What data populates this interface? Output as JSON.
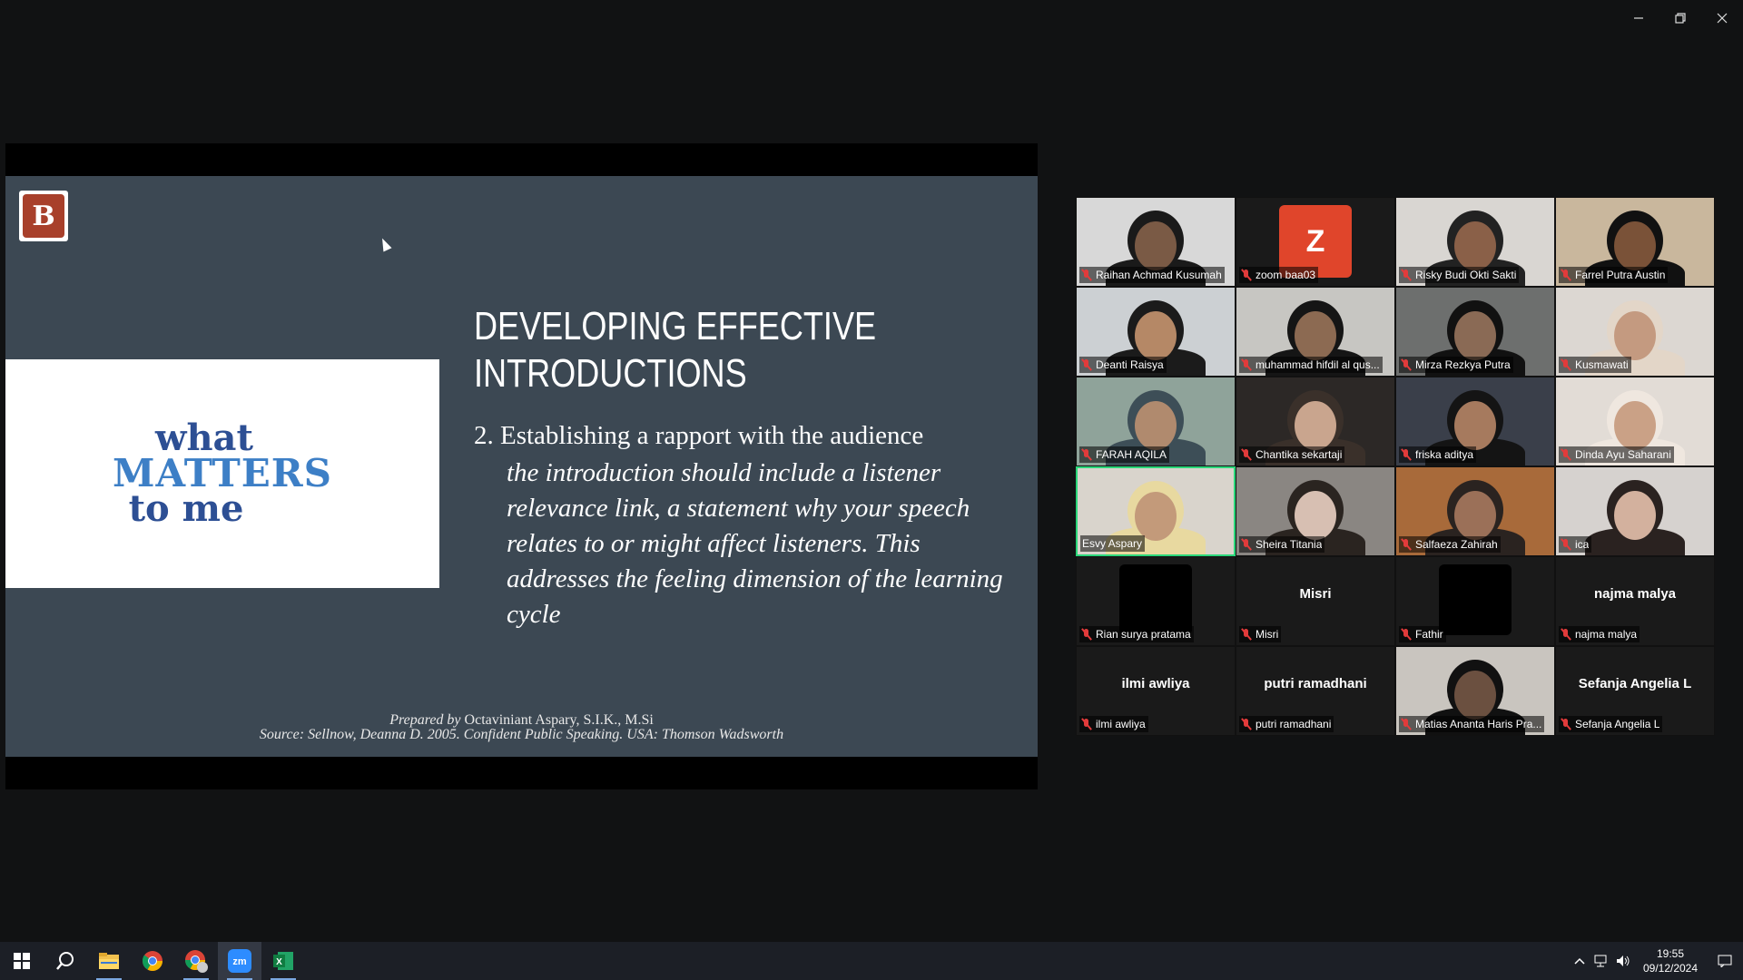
{
  "window": {
    "controls": [
      "minimize",
      "restore",
      "close"
    ]
  },
  "slide": {
    "logo_letter": "B",
    "image_text": [
      "what",
      "MATTERS",
      "to me"
    ],
    "title_line1": "DEVELOPING EFFECTIVE",
    "title_line2": "INTRODUCTIONS",
    "point": "2.  Establishing a rapport with the audience",
    "body": "the introduction should include a listener relevance link, a statement why your speech relates to or might affect listeners. This addresses the feeling dimension of the learning cycle",
    "prepared_label": "Prepared by",
    "prepared_name": "Octaviniant Aspary, S.I.K., M.Si",
    "source": "Source: Sellnow, Deanna D. 2005. Confident Public Speaking. USA: Thomson Wadsworth"
  },
  "participants": [
    {
      "name": "Raihan Achmad Kusumah",
      "type": "video",
      "bg": "#d8d8d8",
      "skin": "#7a5a45",
      "hair": "#1a1a1a"
    },
    {
      "name": "zoom baa03",
      "type": "avatar",
      "letter": "Z"
    },
    {
      "name": "Risky Budi Okti Sakti",
      "type": "video",
      "bg": "#d9d6d2",
      "skin": "#8a6048",
      "hair": "#222"
    },
    {
      "name": "Farrel Putra Austin",
      "type": "video",
      "bg": "#c9b79d",
      "skin": "#7a5238",
      "hair": "#111"
    },
    {
      "name": "Deanti Raisya",
      "type": "video",
      "bg": "#ccd0d3",
      "skin": "#b58866",
      "hair": "#1b1b1b"
    },
    {
      "name": "muhammad hifdil al qus...",
      "type": "video",
      "bg": "#c7c6c2",
      "skin": "#8c6a52",
      "hair": "#151515"
    },
    {
      "name": "Mirza Rezkya Putra",
      "type": "video",
      "bg": "#6d6f6e",
      "skin": "#8a6a55",
      "hair": "#111"
    },
    {
      "name": "Kusmawati",
      "type": "video",
      "bg": "#dcd7d2",
      "skin": "#c49a80",
      "hair": "#e3d6c8"
    },
    {
      "name": "FARAH AQILA",
      "type": "video",
      "bg": "#8fa39a",
      "skin": "#b08a6e",
      "hair": "#3d4e57"
    },
    {
      "name": "Chantika sekartaji",
      "type": "video",
      "bg": "#2c2826",
      "skin": "#c9a58e",
      "hair": "#3a302a"
    },
    {
      "name": "friska aditya",
      "type": "video",
      "bg": "#3a3f4a",
      "skin": "#a67a5e",
      "hair": "#141414"
    },
    {
      "name": "Dinda Ayu Saharani",
      "type": "video",
      "bg": "#e2dcd6",
      "skin": "#caa186",
      "hair": "#efe7df"
    },
    {
      "name": "Esvy Aspary",
      "type": "video",
      "bg": "#d9d4cc",
      "skin": "#c39a7a",
      "hair": "#e8d9a0",
      "active": true
    },
    {
      "name": "Sheira Titania",
      "type": "video",
      "bg": "#8a8682",
      "skin": "#d7bfb2",
      "hair": "#2a2420"
    },
    {
      "name": "Salfaeza Zahirah",
      "type": "video",
      "bg": "#a86a3a",
      "skin": "#9b7058",
      "hair": "#2a2320"
    },
    {
      "name": "ica",
      "type": "video",
      "bg": "#d6d2cf",
      "skin": "#d3b19e",
      "hair": "#2a2220"
    },
    {
      "name": "Rian surya pratama",
      "type": "blank"
    },
    {
      "name": "Misri",
      "type": "name-only"
    },
    {
      "name": "Fathir",
      "type": "blank"
    },
    {
      "name": "najma malya",
      "type": "name-only"
    },
    {
      "name": "ilmi awliya",
      "type": "name-only"
    },
    {
      "name": "putri ramadhani",
      "type": "name-only"
    },
    {
      "name": "Matias Ananta Haris Pra...",
      "type": "video",
      "bg": "#c9c5bf",
      "skin": "#6b5040",
      "hair": "#111"
    },
    {
      "name": "Sefanja Angelia L",
      "type": "name-only"
    }
  ],
  "taskbar": {
    "apps": [
      "start-button",
      "search",
      "file-explorer",
      "chrome",
      "chrome-profile",
      "zoom",
      "excel"
    ],
    "time": "19:55",
    "date": "09/12/2024"
  },
  "colors": {
    "slide_bg": "#3c4853",
    "gallery_bg": "#1a1a1a",
    "active_speaker": "#2bd77a",
    "mic_off": "#e23b3b",
    "zoom_avatar": "#e0452b"
  }
}
